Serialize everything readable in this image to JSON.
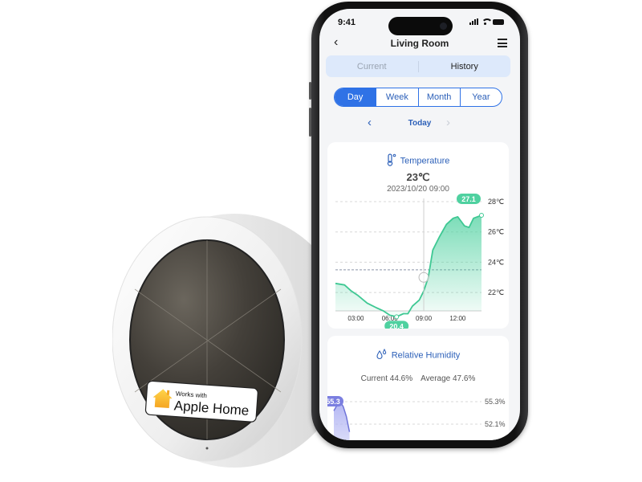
{
  "phone": {
    "status_bar": {
      "time": "9:41",
      "icons": [
        "signal-icon",
        "wifi-icon",
        "battery-icon"
      ]
    },
    "nav": {
      "back_icon": "chevron-left-icon",
      "title": "Living Room",
      "menu_icon": "hamburger-menu-icon"
    },
    "view_tabs": [
      {
        "label": "Current",
        "active": false
      },
      {
        "label": "History",
        "active": true
      }
    ],
    "range_tabs": [
      {
        "label": "Day",
        "active": true
      },
      {
        "label": "Week",
        "active": false
      },
      {
        "label": "Month",
        "active": false
      },
      {
        "label": "Year",
        "active": false
      }
    ],
    "date_nav": {
      "prev_icon": "chevron-left-icon",
      "label": "Today",
      "next_icon": "chevron-right-icon"
    },
    "temperature_card": {
      "icon": "thermometer-icon",
      "title": "Temperature",
      "value": "23℃",
      "timestamp": "2023/10/20 09:00"
    },
    "humidity_card": {
      "icon": "water-drops-icon",
      "title": "Relative Humidity",
      "current": "Current 44.6%",
      "average": "Average 47.6%"
    }
  },
  "device": {
    "badge_small": "Works with",
    "badge_large": "Apple Home",
    "badge_icon": "home-icon"
  },
  "colors": {
    "accent_blue": "#2f72e6",
    "temp_green": "#4fd1a0",
    "humidity_purple": "#7b7fe0",
    "tab_bg": "#dde9fb"
  },
  "chart_data": [
    {
      "type": "area",
      "title": "Temperature",
      "x_ticks": [
        "03:00",
        "06:00",
        "09:00",
        "12:00"
      ],
      "y_ticks": [
        "22℃",
        "24℃",
        "26℃",
        "28℃"
      ],
      "ylim": [
        21,
        28
      ],
      "xlim": [
        1.2,
        14.1
      ],
      "x": [
        1.2,
        2.0,
        2.6,
        3.2,
        4.0,
        4.8,
        5.4,
        6.0,
        6.6,
        7.2,
        7.6,
        8.0,
        8.6,
        9.0,
        9.4,
        9.8,
        10.4,
        11.0,
        11.6,
        12.0,
        12.6,
        13.0,
        13.4,
        14.1
      ],
      "y": [
        22.6,
        22.5,
        22.1,
        21.8,
        21.3,
        21.0,
        20.8,
        20.5,
        20.4,
        20.6,
        20.6,
        21.1,
        21.5,
        22.1,
        23.0,
        24.8,
        25.7,
        26.5,
        26.9,
        27.0,
        26.4,
        26.3,
        26.9,
        27.1
      ],
      "cursor": {
        "x": 9.0,
        "label": "09:00",
        "value": 23
      },
      "reference_line": 23.5,
      "max_label": "27.1",
      "min_label": "20.4",
      "grid": true
    },
    {
      "type": "area",
      "title": "Relative Humidity",
      "y_ticks": [
        "55.3%",
        "52.1%"
      ],
      "max_label": "55.3",
      "summary": {
        "current": 44.6,
        "average": 47.6
      },
      "partial": true,
      "x": [
        0,
        0.3,
        0.6,
        0.9,
        1.2,
        1.5
      ],
      "y": [
        54.0,
        54.8,
        55.3,
        54.6,
        53.2,
        51.0
      ]
    }
  ]
}
